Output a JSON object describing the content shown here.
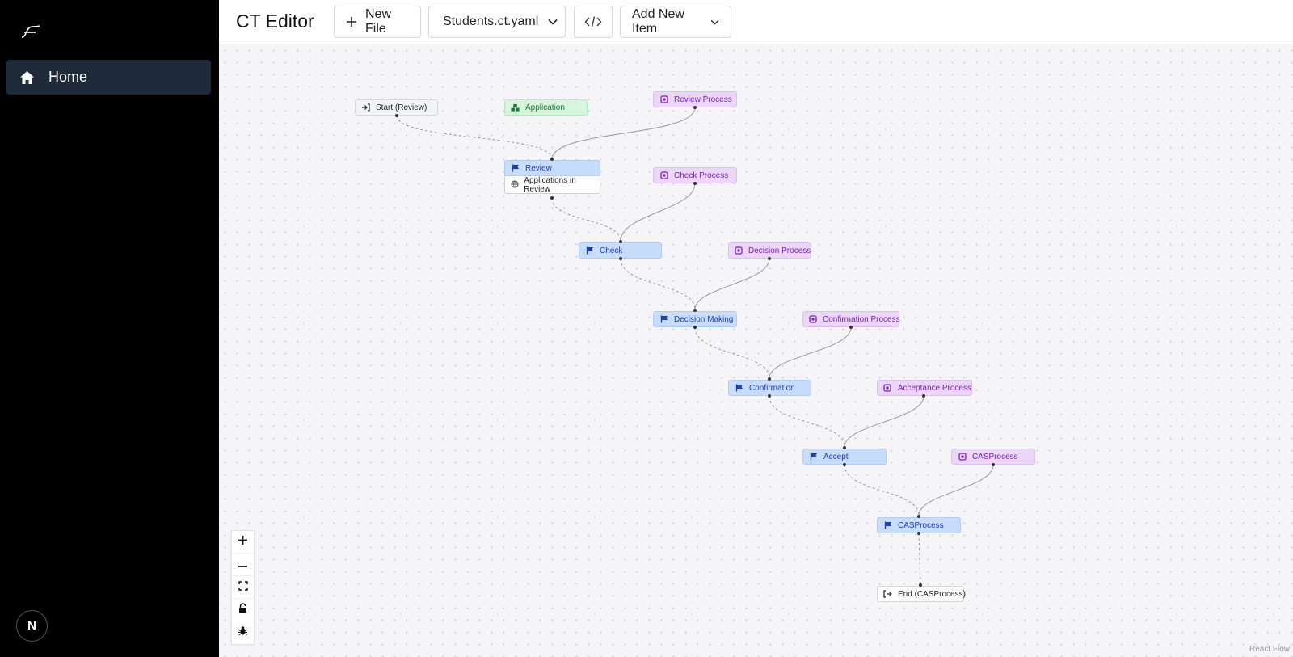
{
  "sidebar": {
    "logo_icon": "curve-logo-icon",
    "nav": {
      "home_label": "Home",
      "home_icon": "home-icon"
    },
    "avatar_initial": "N"
  },
  "toolbar": {
    "title": "CT Editor",
    "new_file_label": "New File",
    "file_select_label": "Students.ct.yaml",
    "code_icon": "code-icon",
    "add_item_label": "Add New Item"
  },
  "flow": {
    "nodes": {
      "start": "Start (Review)",
      "application": "Application",
      "review_process": "Review Process",
      "review": "Review",
      "review_sub": "Applications in Review",
      "check_process": "Check Process",
      "check": "Check",
      "decision_process": "Decision Process",
      "decision_making": "Decision Making",
      "confirmation_process": "Confirmation Process",
      "confirmation": "Confirmation",
      "acceptance_process": "Acceptance Process",
      "accept": "Accept",
      "casprocess_proc": "CASProcess",
      "casprocess": "CASProcess",
      "end": "End (CASProcess)"
    }
  },
  "controls": {
    "zoom_in_icon": "plus-icon",
    "zoom_out_icon": "minus-icon",
    "fit_view_icon": "fullscreen-icon",
    "lock_icon": "lock-icon",
    "debug_icon": "bug-icon"
  },
  "attribution": "React Flow",
  "colors": {
    "sidebar_bg": "#000000",
    "nav_active_bg": "#1e2a3a",
    "state_node": "#c8dcfb",
    "process_node": "#ecd6f7",
    "data_node": "#d7f5dd",
    "terminal_node": "#f3f4f6"
  }
}
